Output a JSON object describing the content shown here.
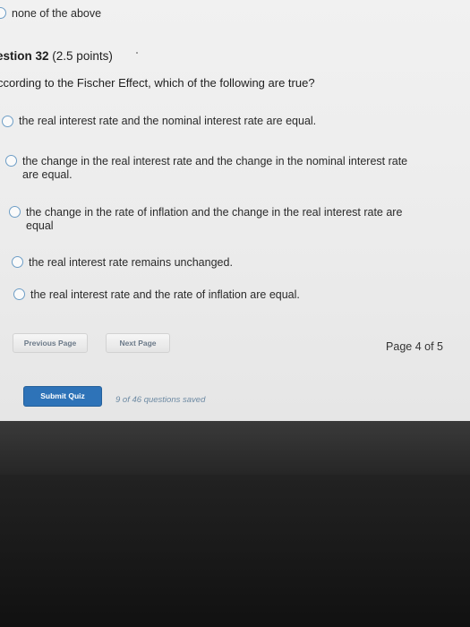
{
  "previous_question": {
    "option_text": "none of the above"
  },
  "question": {
    "heading": "estion 32",
    "points": "(2.5 points)",
    "prompt": "ccording to the Fischer Effect, which of the following are true?",
    "options": [
      {
        "line1": "the real interest rate and the nominal interest rate are equal.",
        "line2": ""
      },
      {
        "line1": "the change in the real interest rate and the change in the nominal interest rate",
        "line2": "are equal."
      },
      {
        "line1": "the change in the rate of inflation and the change in the real interest rate are",
        "line2": "equal"
      },
      {
        "line1": "the real interest rate remains unchanged.",
        "line2": ""
      },
      {
        "line1": "the real interest rate and the rate of inflation are equal.",
        "line2": ""
      }
    ]
  },
  "navigation": {
    "previous_label": "Previous Page",
    "next_label": "Next Page",
    "page_indicator": "Page 4 of 5"
  },
  "submit": {
    "label": "Submit Quiz",
    "saved_status": "9 of 46 questions saved"
  },
  "colors": {
    "radio_border": "#6e9ec6",
    "submit_bg": "#2e73b8",
    "saved_text": "#6d8aa3"
  }
}
